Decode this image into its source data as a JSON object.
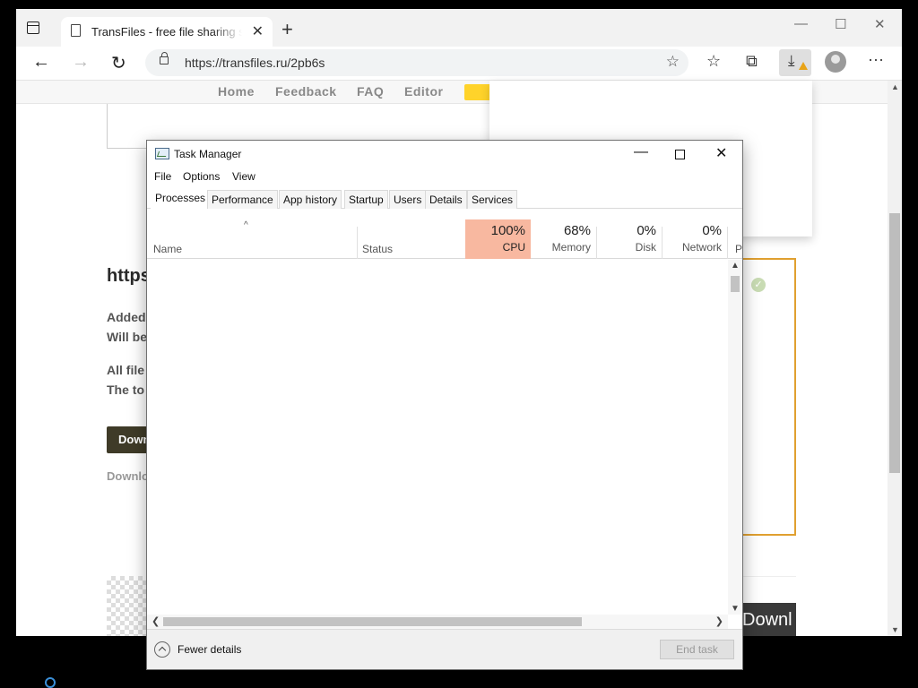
{
  "browser": {
    "tab_title": "TransFiles - free file sharing service",
    "tab_close": "✕",
    "new_tab": "+",
    "window_controls": {
      "minimize": "—",
      "maximize": "☐",
      "close": "✕"
    },
    "nav": {
      "back": "←",
      "forward": "→",
      "reload": "↻"
    },
    "url": "https://transfiles.ru/2pb6s",
    "toolbar_glyphs": {
      "favorites": "☆",
      "collections": "⧉",
      "downloads": "⤓",
      "more": "···",
      "add_favorite": "☆"
    }
  },
  "site": {
    "nav": [
      "Home",
      "Feedback",
      "FAQ",
      "Editor"
    ],
    "heading": "https",
    "text_lines": [
      "Added",
      "Will be",
      "All file",
      "The to"
    ],
    "download_button": "Down",
    "download_link": "Downlo",
    "right_button": "Downl",
    "accent_color": "#ffd32a",
    "frame_color": "#e0a030"
  },
  "taskmgr": {
    "title": "Task Manager",
    "controls": {
      "minimize": "—",
      "close": "✕"
    },
    "menu": [
      "File",
      "Options",
      "View"
    ],
    "tabs": [
      "Processes",
      "Performance",
      "App history",
      "Startup",
      "Users",
      "Details",
      "Services"
    ],
    "active_tab": "Processes",
    "columns": {
      "name": "Name",
      "status": "Status",
      "cpu": {
        "pct": "100%",
        "label": "CPU"
      },
      "memory": {
        "pct": "68%",
        "label": "Memory"
      },
      "disk": {
        "pct": "0%",
        "label": "Disk"
      },
      "network": {
        "pct": "0%",
        "label": "Network"
      },
      "power": "P"
    },
    "sort_indicator": "^",
    "scroll_glyphs": {
      "up": "▲",
      "down": "▼",
      "left": "❮",
      "right": "❯"
    },
    "fewer_details": "Fewer details",
    "end_task": "End task",
    "cpu_highlight_color": "#f8b8a0"
  }
}
